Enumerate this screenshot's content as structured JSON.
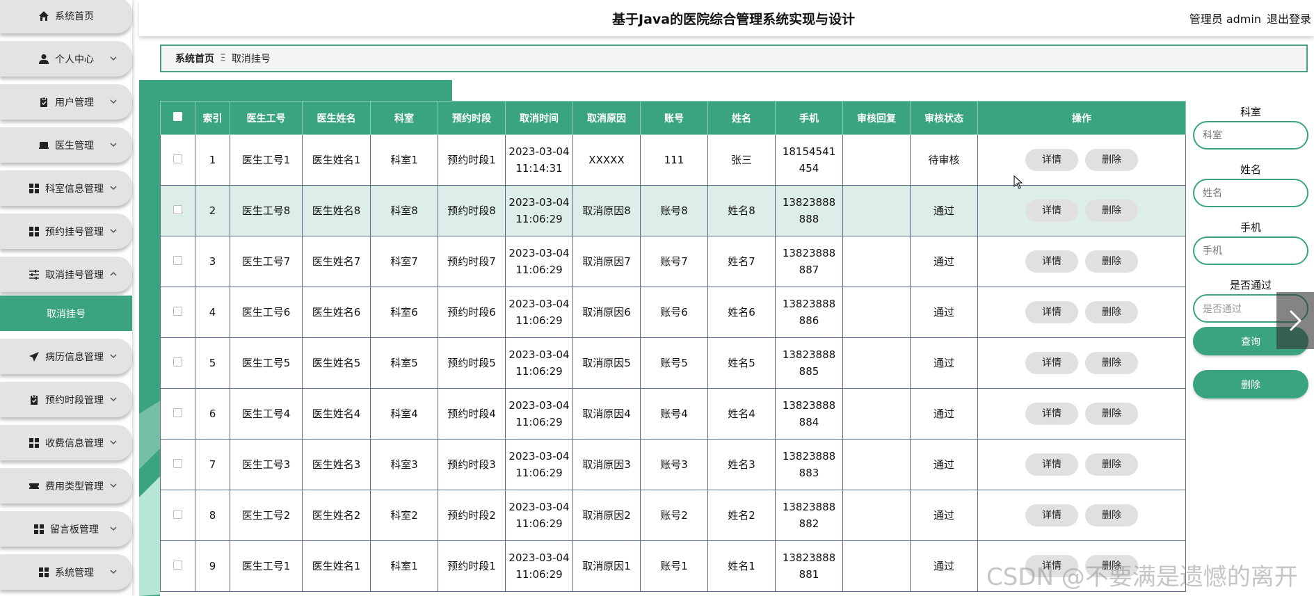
{
  "app": {
    "title": "基于Java的医院综合管理系统实现与设计",
    "user_label": "管理员 admin",
    "logout_label": "退出登录",
    "accent_color": "#3aa47e"
  },
  "sidebar": {
    "items": [
      {
        "label": "系统首页",
        "icon": "home-icon"
      },
      {
        "label": "个人中心",
        "icon": "user-icon"
      },
      {
        "label": "用户管理",
        "icon": "clipboard-icon"
      },
      {
        "label": "医生管理",
        "icon": "monitor-icon"
      },
      {
        "label": "科室信息管理",
        "icon": "grid-icon"
      },
      {
        "label": "预约挂号管理",
        "icon": "grid-icon"
      },
      {
        "label": "取消挂号管理",
        "icon": "sliders-icon"
      },
      {
        "label": "病历信息管理",
        "icon": "send-icon"
      },
      {
        "label": "预约时段管理",
        "icon": "clipboard-icon"
      },
      {
        "label": "收费信息管理",
        "icon": "grid-icon"
      },
      {
        "label": "费用类型管理",
        "icon": "ticket-icon"
      },
      {
        "label": "留言板管理",
        "icon": "grid-icon"
      },
      {
        "label": "系统管理",
        "icon": "grid-icon"
      }
    ],
    "active_sub": "取消挂号"
  },
  "breadcrumb": {
    "home": "系统首页",
    "separator": "Ξ",
    "current": "取消挂号"
  },
  "table": {
    "headers": [
      "索引",
      "医生工号",
      "医生姓名",
      "科室",
      "预约时段",
      "取消时间",
      "取消原因",
      "账号",
      "姓名",
      "手机",
      "审核回复",
      "审核状态",
      "操作"
    ],
    "rows": [
      {
        "index": "1",
        "doctor_id": "医生工号1",
        "doctor_name": "医生姓名1",
        "dept": "科室1",
        "slot": "预约时段1",
        "cancel_time": "2023-03-04 11:14:31",
        "reason": "XXXXX",
        "account": "111",
        "name": "张三",
        "phone": "18154541454",
        "reply": "",
        "status": "待审核"
      },
      {
        "index": "2",
        "doctor_id": "医生工号8",
        "doctor_name": "医生姓名8",
        "dept": "科室8",
        "slot": "预约时段8",
        "cancel_time": "2023-03-04 11:06:29",
        "reason": "取消原因8",
        "account": "账号8",
        "name": "姓名8",
        "phone": "13823888888",
        "reply": "",
        "status": "通过"
      },
      {
        "index": "3",
        "doctor_id": "医生工号7",
        "doctor_name": "医生姓名7",
        "dept": "科室7",
        "slot": "预约时段7",
        "cancel_time": "2023-03-04 11:06:29",
        "reason": "取消原因7",
        "account": "账号7",
        "name": "姓名7",
        "phone": "13823888887",
        "reply": "",
        "status": "通过"
      },
      {
        "index": "4",
        "doctor_id": "医生工号6",
        "doctor_name": "医生姓名6",
        "dept": "科室6",
        "slot": "预约时段6",
        "cancel_time": "2023-03-04 11:06:29",
        "reason": "取消原因6",
        "account": "账号6",
        "name": "姓名6",
        "phone": "13823888886",
        "reply": "",
        "status": "通过"
      },
      {
        "index": "5",
        "doctor_id": "医生工号5",
        "doctor_name": "医生姓名5",
        "dept": "科室5",
        "slot": "预约时段5",
        "cancel_time": "2023-03-04 11:06:29",
        "reason": "取消原因5",
        "account": "账号5",
        "name": "姓名5",
        "phone": "13823888885",
        "reply": "",
        "status": "通过"
      },
      {
        "index": "6",
        "doctor_id": "医生工号4",
        "doctor_name": "医生姓名4",
        "dept": "科室4",
        "slot": "预约时段4",
        "cancel_time": "2023-03-04 11:06:29",
        "reason": "取消原因4",
        "account": "账号4",
        "name": "姓名4",
        "phone": "13823888884",
        "reply": "",
        "status": "通过"
      },
      {
        "index": "7",
        "doctor_id": "医生工号3",
        "doctor_name": "医生姓名3",
        "dept": "科室3",
        "slot": "预约时段3",
        "cancel_time": "2023-03-04 11:06:29",
        "reason": "取消原因3",
        "account": "账号3",
        "name": "姓名3",
        "phone": "13823888883",
        "reply": "",
        "status": "通过"
      },
      {
        "index": "8",
        "doctor_id": "医生工号2",
        "doctor_name": "医生姓名2",
        "dept": "科室2",
        "slot": "预约时段2",
        "cancel_time": "2023-03-04 11:06:29",
        "reason": "取消原因2",
        "account": "账号2",
        "name": "姓名2",
        "phone": "13823888882",
        "reply": "",
        "status": "通过"
      },
      {
        "index": "9",
        "doctor_id": "医生工号1",
        "doctor_name": "医生姓名1",
        "dept": "科室1",
        "slot": "预约时段1",
        "cancel_time": "2023-03-04 11:06:29",
        "reason": "取消原因1",
        "account": "账号1",
        "name": "姓名1",
        "phone": "13823888881",
        "reply": "",
        "status": "通过"
      }
    ],
    "detail_label": "详情",
    "delete_label": "删除"
  },
  "filters": {
    "dept_label": "科室",
    "dept_placeholder": "科室",
    "name_label": "姓名",
    "name_placeholder": "姓名",
    "phone_label": "手机",
    "phone_placeholder": "手机",
    "pass_label": "是否通过",
    "pass_placeholder": "是否通过",
    "query_label": "查询",
    "delete_label": "删除"
  },
  "watermark": "CSDN @不要满是遗憾的离开"
}
